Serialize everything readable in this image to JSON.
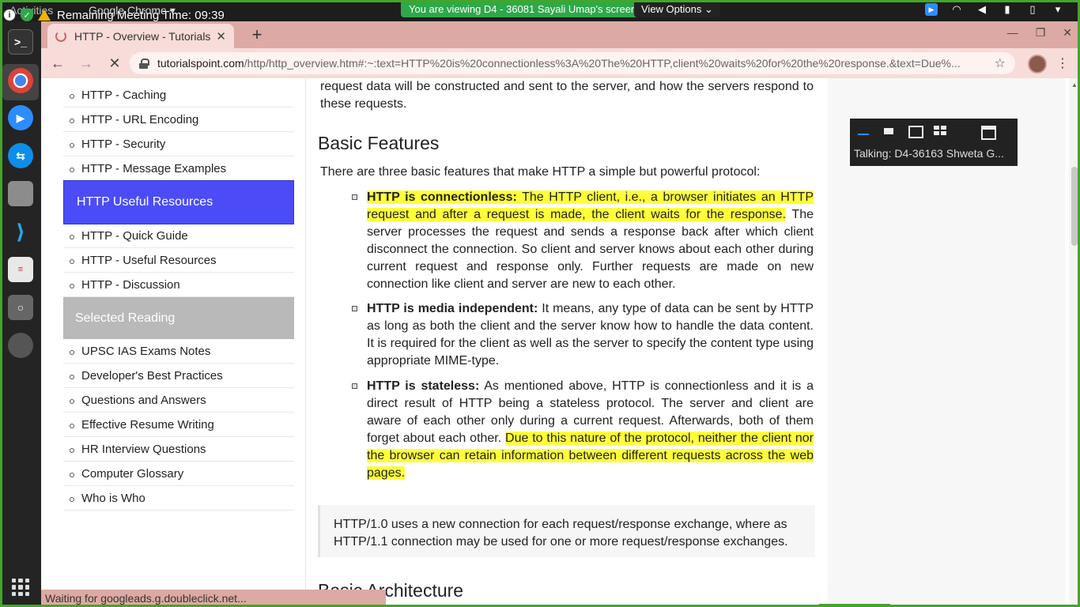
{
  "topbar": {
    "activities": "Activities",
    "chrome_menu": "Google Chrome ▾",
    "meeting_time": "Remaining Meeting Time: 09:39",
    "viewing_banner": "You are viewing D4 - 36081 Sayali Umap's screen",
    "view_options": "View Options ⌄"
  },
  "browser": {
    "tab_title": "HTTP - Overview - Tutorials",
    "url_host": "tutorialspoint.com",
    "url_path": "/http/http_overview.htm#:~:text=HTTP%20is%20connectionless%3A%20The%20HTTP,client%20waits%20for%20the%20response.&text=Due%...",
    "status": "Waiting for googleads.g.doubleclick.net..."
  },
  "sidebar": {
    "top_items": [
      "HTTP - Caching",
      "HTTP - URL Encoding",
      "HTTP - Security",
      "HTTP - Message Examples"
    ],
    "useful_heading": "HTTP Useful Resources",
    "useful_items": [
      "HTTP - Quick Guide",
      "HTTP - Useful Resources",
      "HTTP - Discussion"
    ],
    "reading_heading": "Selected Reading",
    "reading_items": [
      "UPSC IAS Exams Notes",
      "Developer's Best Practices",
      "Questions and Answers",
      "Effective Resume Writing",
      "HR Interview Questions",
      "Computer Glossary",
      "Who is Who"
    ]
  },
  "content": {
    "lead": "request data will be constructed and sent to the server, and how the servers respond to these requests.",
    "heading": "Basic Features",
    "intro": "There are three basic features that make HTTP a simple but powerful protocol:",
    "b1_bold": "HTTP is connectionless:",
    "b1_hl": " The HTTP client, i.e., a browser initiates an HTTP request and after a request is made, the client waits for the response.",
    "b1_rest": " The server processes the request and sends a response back after which client disconnect the connection. So client and server knows about each other during current request and response only. Further requests are made on new connection like client and server are new to each other.",
    "b2_bold": "HTTP is media independent:",
    "b2_rest": " It means, any type of data can be sent by HTTP as long as both the client and the server know how to handle the data content. It is required for the client as well as the server to specify the content type using appropriate MIME-type.",
    "b3_bold": "HTTP is stateless:",
    "b3_rest": " As mentioned above, HTTP is connectionless and it is a direct result of HTTP being a stateless protocol. The server and client are aware of each other only during a current request. Afterwards, both of them forget about each other. ",
    "b3_hl": "Due to this nature of the protocol, neither the client nor the browser can retain information between different requests across the web pages.",
    "note": "HTTP/1.0 uses a new connection for each request/response exchange, where as HTTP/1.1 connection may be used for one or more request/response exchanges.",
    "next_heading": "Basic Architecture"
  },
  "zoom_widget": {
    "talking": "Talking: D4-36163 Shweta G..."
  },
  "colors": {
    "share_border": "#44a52a",
    "sidebar_blue": "#4b4cf7",
    "highlight": "#ffff3b",
    "tab_strip": "#dda9a4"
  }
}
